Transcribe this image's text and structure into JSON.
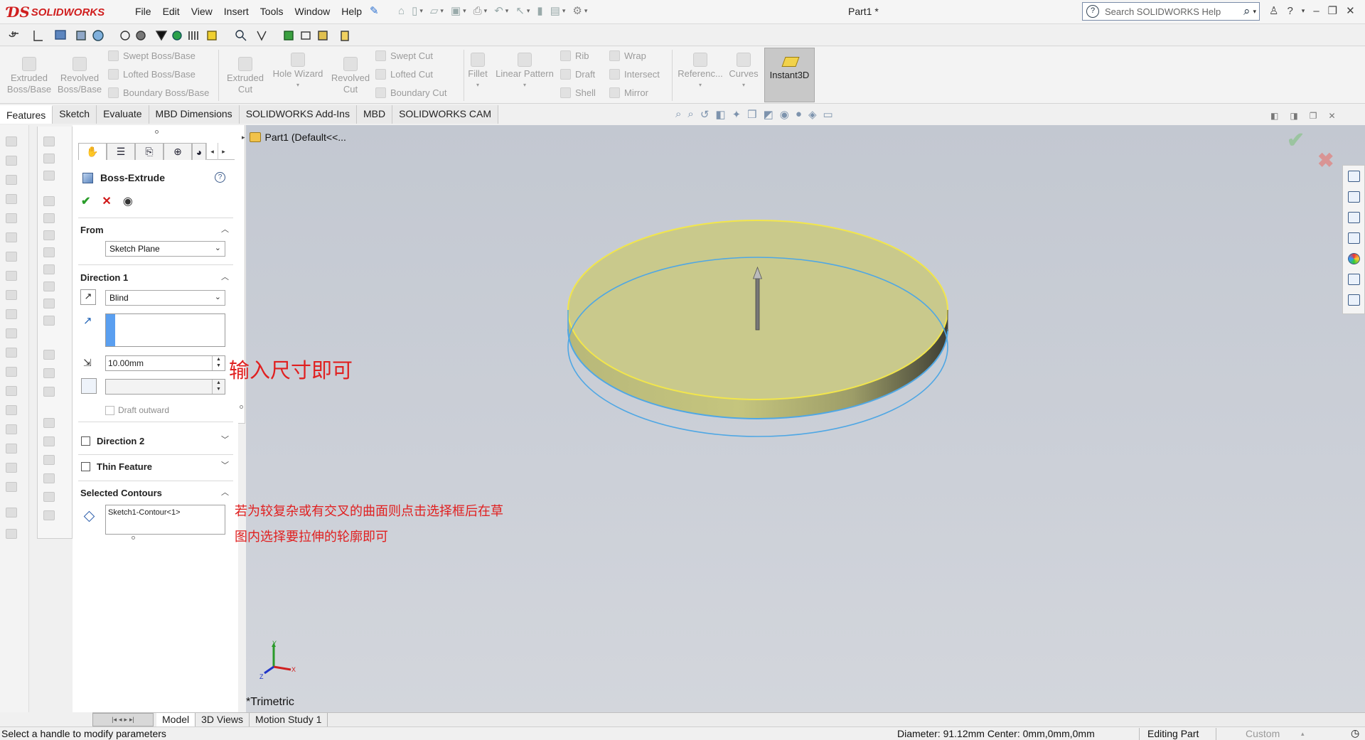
{
  "app": {
    "name": "SOLIDWORKS",
    "doc_title": "Part1 *"
  },
  "menu": [
    "File",
    "Edit",
    "View",
    "Insert",
    "Tools",
    "Window",
    "Help"
  ],
  "search": {
    "placeholder": "Search SOLIDWORKS Help"
  },
  "ribbon": {
    "extruded_boss": "Extruded\nBoss/Base",
    "revolved_boss": "Revolved\nBoss/Base",
    "swept_boss": "Swept Boss/Base",
    "lofted_boss": "Lofted Boss/Base",
    "boundary_boss": "Boundary Boss/Base",
    "extruded_cut": "Extruded\nCut",
    "hole_wizard": "Hole Wizard",
    "revolved_cut": "Revolved\nCut",
    "swept_cut": "Swept Cut",
    "lofted_cut": "Lofted Cut",
    "boundary_cut": "Boundary Cut",
    "fillet": "Fillet",
    "linear_pattern": "Linear Pattern",
    "rib": "Rib",
    "draft": "Draft",
    "shell": "Shell",
    "wrap": "Wrap",
    "intersect": "Intersect",
    "mirror": "Mirror",
    "reference": "Referenc...",
    "curves": "Curves",
    "instant3d": "Instant3D"
  },
  "tabs": [
    "Features",
    "Sketch",
    "Evaluate",
    "MBD Dimensions",
    "SOLIDWORKS Add-Ins",
    "MBD",
    "SOLIDWORKS CAM"
  ],
  "property_manager": {
    "title": "Boss-Extrude",
    "from": {
      "label": "From",
      "value": "Sketch Plane"
    },
    "direction1": {
      "label": "Direction 1",
      "end_condition": "Blind",
      "depth": "10.00mm",
      "draft_label": "Draft outward"
    },
    "direction2": {
      "label": "Direction 2"
    },
    "thin_feature": {
      "label": "Thin Feature"
    },
    "selected_contours": {
      "label": "Selected Contours",
      "value": "Sketch1-Contour<1>"
    }
  },
  "tree": {
    "root": "Part1  (Default<<..."
  },
  "annotations": {
    "note1": "输入尺寸即可",
    "note2_line1": "若为较复杂或有交叉的曲面则点击选择框后在草",
    "note2_line2": "图内选择要拉伸的轮廓即可"
  },
  "view": {
    "orientation": "*Trimetric"
  },
  "bottom_tabs": [
    "Model",
    "3D Views",
    "Motion Study 1"
  ],
  "status": {
    "message": "Select a handle to modify parameters",
    "measure": "Diameter: 91.12mm  Center: 0mm,0mm,0mm",
    "mode": "Editing Part",
    "units": "Custom"
  },
  "colors": {
    "brand": "#d01e1e",
    "annotation": "#e02020",
    "top_face": "#c9c98c",
    "edge_yellow": "#f2e64b",
    "edge_blue": "#4fa7e4"
  }
}
